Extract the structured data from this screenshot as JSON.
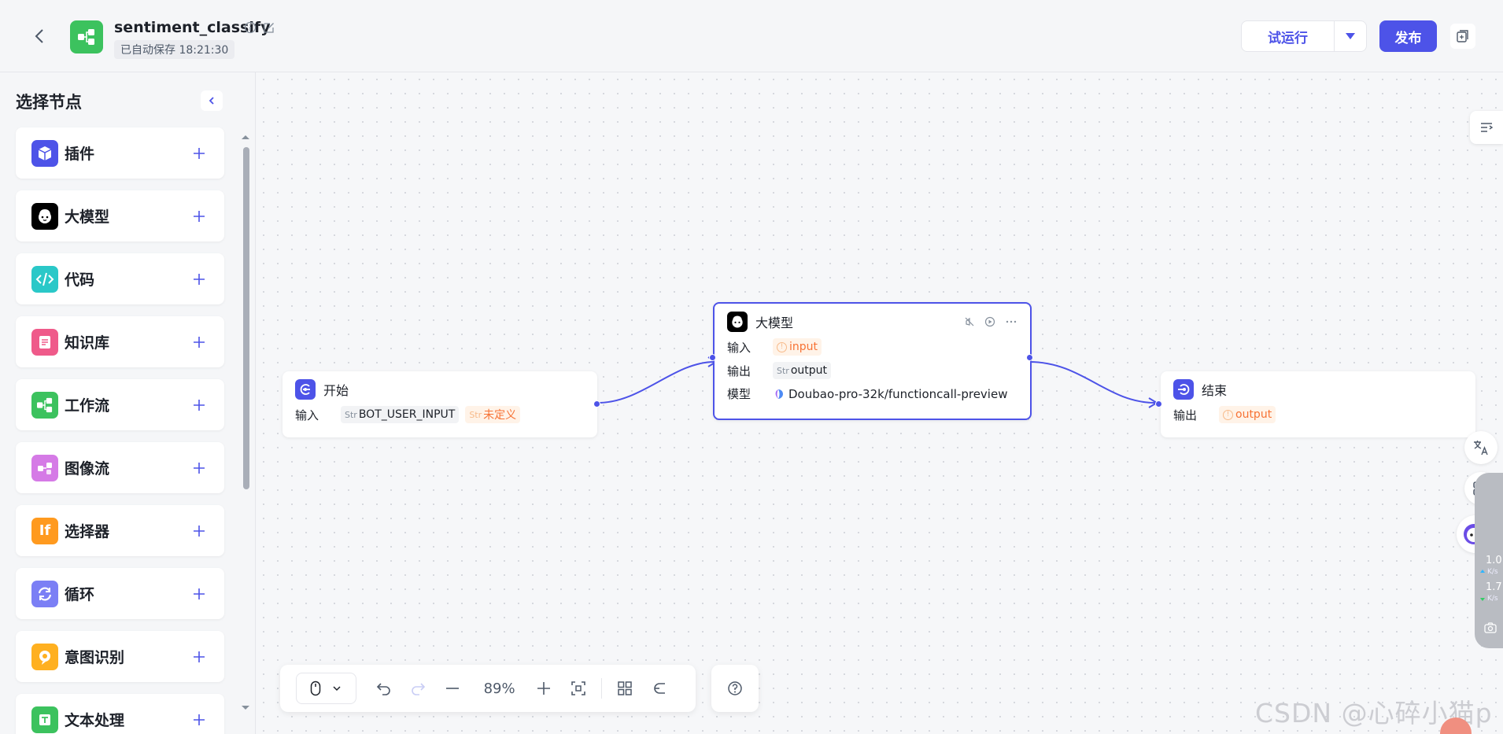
{
  "header": {
    "title": "sentiment_classify",
    "saved_text": "已自动保存 18:21:30",
    "run_label": "试运行",
    "publish_label": "发布"
  },
  "sidebar": {
    "title": "选择节点",
    "items": [
      {
        "label": "插件",
        "icon": "cube-icon",
        "color": "#4d53e8"
      },
      {
        "label": "大模型",
        "icon": "llm-face-icon",
        "color": "#000000"
      },
      {
        "label": "代码",
        "icon": "code-icon",
        "color": "#2ac8c8"
      },
      {
        "label": "知识库",
        "icon": "knowledge-icon",
        "color": "#ef5a8a"
      },
      {
        "label": "工作流",
        "icon": "workflow-icon",
        "color": "#3cc25e"
      },
      {
        "label": "图像流",
        "icon": "imageflow-icon",
        "color": "#d57ae6"
      },
      {
        "label": "选择器",
        "icon": "if-icon",
        "color": "#ff9a1f",
        "glyph": "If"
      },
      {
        "label": "循环",
        "icon": "loop-icon",
        "color": "#7b7ff5"
      },
      {
        "label": "意图识别",
        "icon": "intent-icon",
        "color": "#ffb020"
      },
      {
        "label": "文本处理",
        "icon": "text-icon",
        "color": "#3cc25e"
      }
    ]
  },
  "canvas": {
    "start_node": {
      "title": "开始",
      "input_label": "输入",
      "param_type": "Str",
      "param_name": "BOT_USER_INPUT",
      "undefined_type": "Str",
      "undefined_label": "未定义"
    },
    "llm_node": {
      "title": "大模型",
      "input_label": "输入",
      "input_value": "input",
      "output_label": "输出",
      "output_type": "Str",
      "output_value": "output",
      "model_label": "模型",
      "model_value": "Doubao-pro-32k/functioncall-preview"
    },
    "end_node": {
      "title": "结束",
      "output_label": "输出",
      "output_value": "output"
    }
  },
  "toolbar": {
    "zoom": "89%"
  },
  "network": {
    "up": "1.0",
    "down": "1.7",
    "unit": "K/s"
  },
  "watermark": "CSDN @心碎小猫p",
  "colors": {
    "accent": "#4d53e8",
    "workflow_green": "#3cc25e",
    "warn_orange": "#f77234"
  }
}
